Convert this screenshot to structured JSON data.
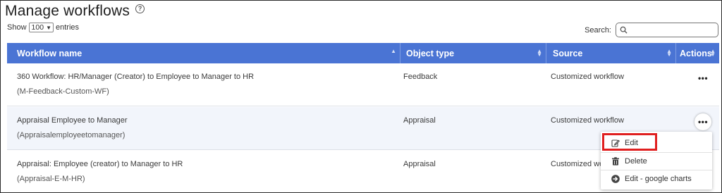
{
  "page": {
    "title": "Manage workflows"
  },
  "length": {
    "show_label": "Show",
    "selected": "100",
    "entries_label": "entries"
  },
  "search": {
    "label": "Search:",
    "value": ""
  },
  "table": {
    "headers": {
      "name": "Workflow name",
      "type": "Object type",
      "source": "Source",
      "actions": "Actions"
    },
    "rows": [
      {
        "name": "360 Workflow: HR/Manager (Creator) to Employee to Manager to HR",
        "code": "(M-Feedback-Custom-WF)",
        "type": "Feedback",
        "source": "Customized workflow"
      },
      {
        "name": "Appraisal Employee to Manager",
        "code": "(Appraisalemployeetomanager)",
        "type": "Appraisal",
        "source": "Customized workflow"
      },
      {
        "name": "Appraisal: Employee (creator) to Manager to HR",
        "code": "(Appraisal-E-M-HR)",
        "type": "Appraisal",
        "source": "Customized workflow"
      }
    ],
    "more_glyph": "•••"
  },
  "menu": {
    "items": [
      {
        "label": "Edit",
        "icon": "edit-icon"
      },
      {
        "label": "Delete",
        "icon": "trash-icon"
      },
      {
        "label": "Edit - google charts",
        "icon": "arrow-circle-icon"
      }
    ]
  },
  "colors": {
    "header_bg": "#4a74d4",
    "highlight": "#e01f1f",
    "row_alt": "#f2f5fb"
  }
}
